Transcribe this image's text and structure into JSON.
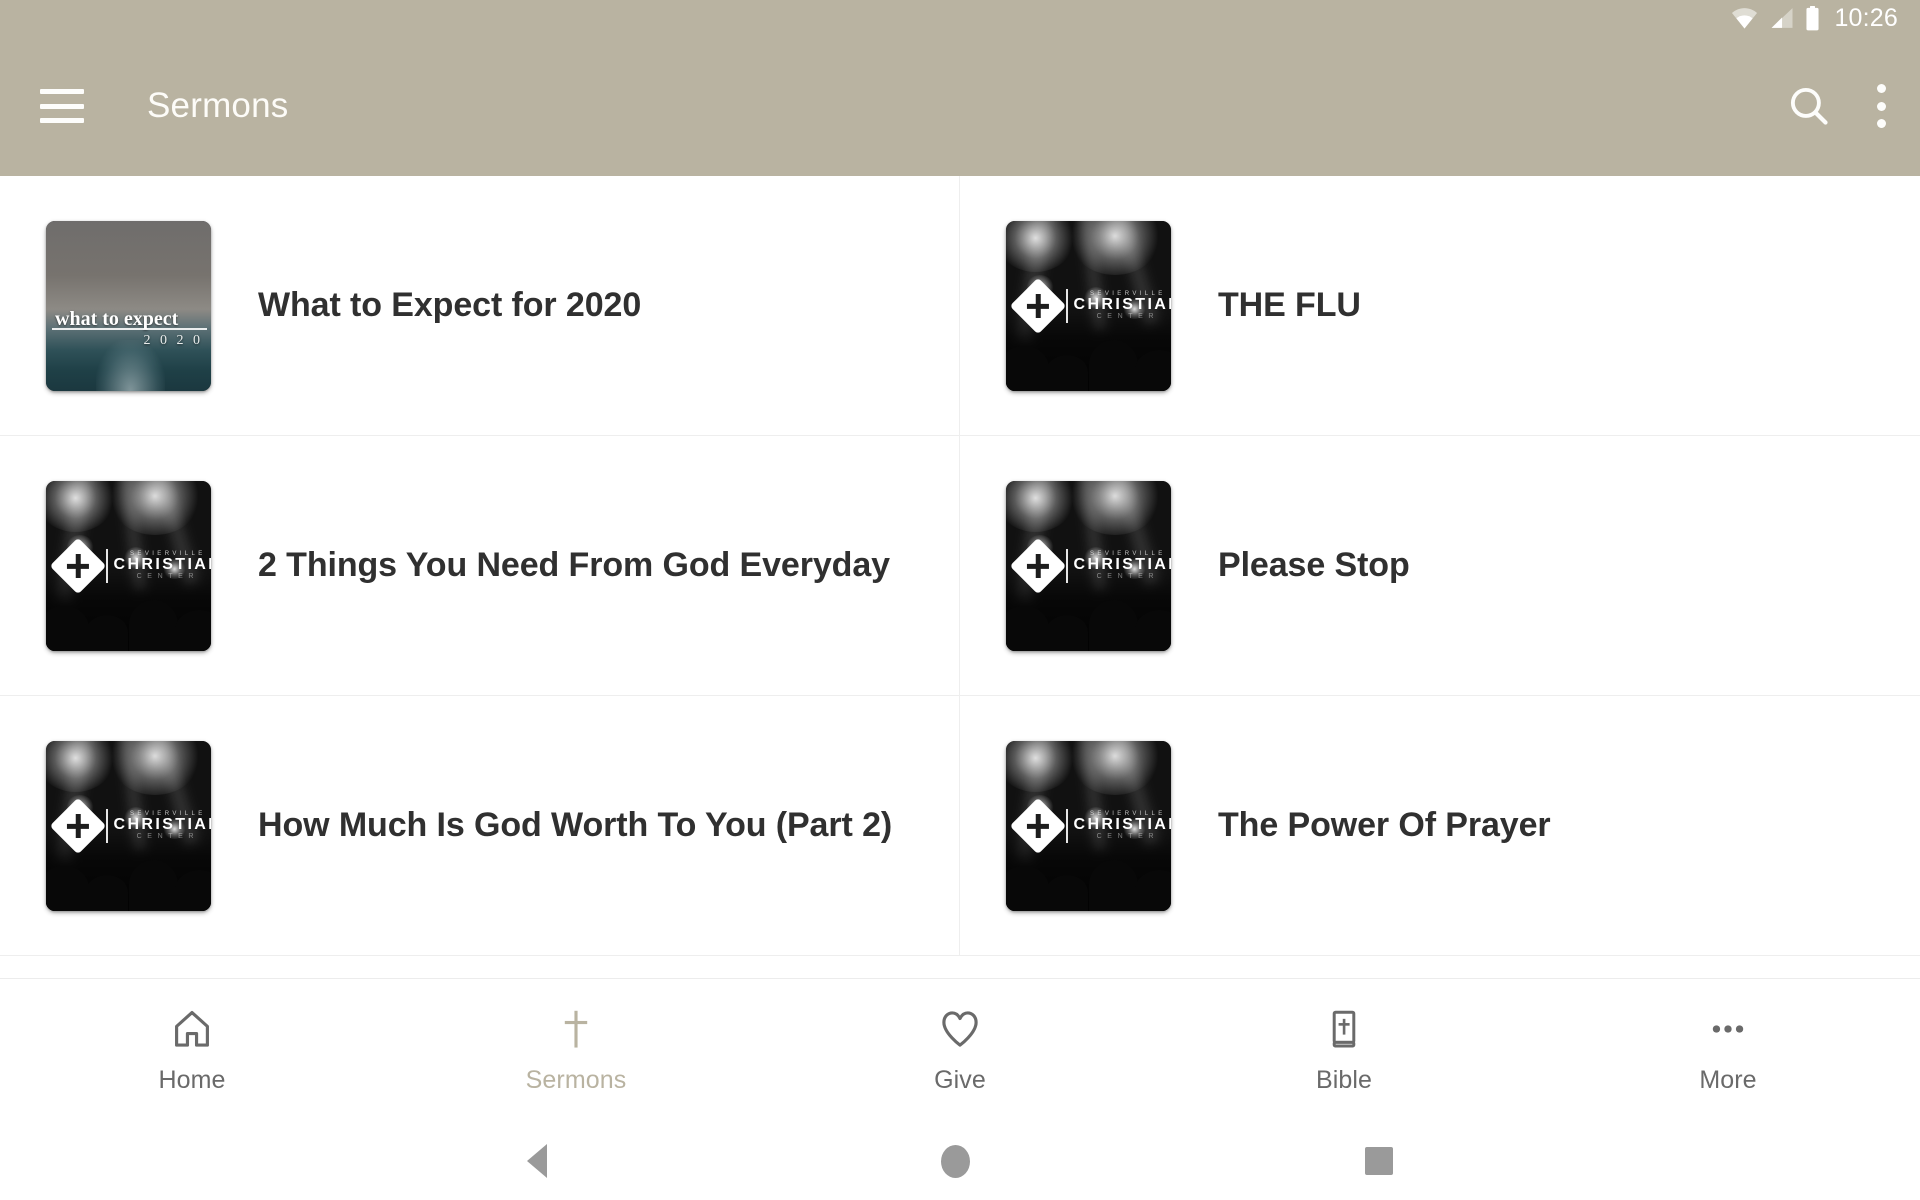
{
  "status_bar": {
    "time": "10:26",
    "icons": [
      "wifi-icon",
      "cell-signal-icon",
      "battery-icon"
    ]
  },
  "app_bar": {
    "menu_icon": "hamburger-menu-icon",
    "title": "Sermons",
    "search_icon": "search-icon",
    "overflow_icon": "overflow-menu-icon",
    "background_color": "#b9b3a1",
    "text_color": "#fdfcf8"
  },
  "sermons": [
    {
      "title": "What to Expect for 2020",
      "thumbnail": "what-to-expect-artwork",
      "artwork_text": {
        "headline": "what to expect",
        "year": "2 0 2 0"
      }
    },
    {
      "title": "THE FLU",
      "thumbnail": "church-logo-artwork",
      "artwork_text": {
        "top": "SEVIERVILLE",
        "middle": "CHRISTIAN",
        "bottom": "CENTER"
      }
    },
    {
      "title": "2 Things You Need From God Everyday",
      "thumbnail": "church-logo-artwork",
      "artwork_text": {
        "top": "SEVIERVILLE",
        "middle": "CHRISTIAN",
        "bottom": "CENTER"
      }
    },
    {
      "title": "Please Stop",
      "thumbnail": "church-logo-artwork",
      "artwork_text": {
        "top": "SEVIERVILLE",
        "middle": "CHRISTIAN",
        "bottom": "CENTER"
      }
    },
    {
      "title": "How Much Is God Worth To You (Part 2)",
      "thumbnail": "church-logo-artwork",
      "artwork_text": {
        "top": "SEVIERVILLE",
        "middle": "CHRISTIAN",
        "bottom": "CENTER"
      }
    },
    {
      "title": "The Power Of Prayer",
      "thumbnail": "church-logo-artwork",
      "artwork_text": {
        "top": "SEVIERVILLE",
        "middle": "CHRISTIAN",
        "bottom": "CENTER"
      }
    }
  ],
  "bottom_nav": {
    "active_color": "#b9b3a1",
    "inactive_color": "#6a6a6a",
    "items": [
      {
        "label": "Home",
        "icon": "home-icon",
        "active": false
      },
      {
        "label": "Sermons",
        "icon": "cross-icon",
        "active": true
      },
      {
        "label": "Give",
        "icon": "heart-icon",
        "active": false
      },
      {
        "label": "Bible",
        "icon": "bible-icon",
        "active": false
      },
      {
        "label": "More",
        "icon": "more-dots-icon",
        "active": false
      }
    ]
  },
  "android_nav": {
    "back": "back-triangle-icon",
    "home": "home-circle-icon",
    "recents": "recents-square-icon"
  }
}
